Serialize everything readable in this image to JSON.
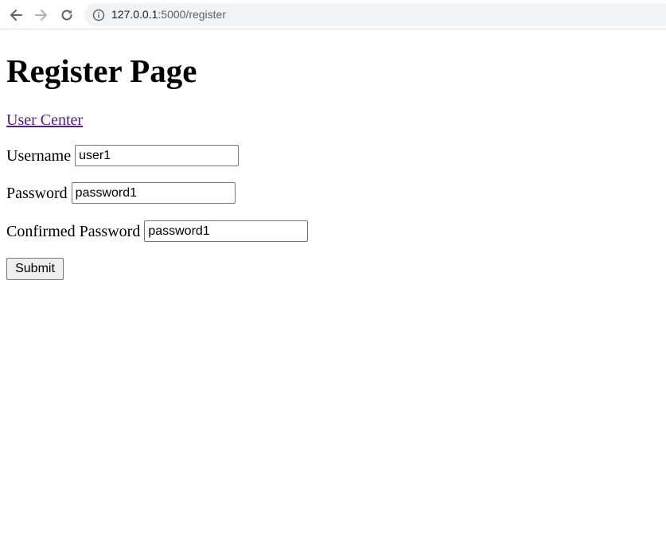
{
  "browser": {
    "url_host": "127.0.0.1",
    "url_path": ":5000/register",
    "back_icon": "arrow-left-icon",
    "forward_icon": "arrow-right-icon",
    "reload_icon": "reload-icon",
    "info_icon": "info-icon"
  },
  "page": {
    "title": "Register Page",
    "user_center_link": "User Center"
  },
  "form": {
    "username_label": "Username",
    "username_value": "user1",
    "password_label": "Password",
    "password_value": "password1",
    "confirm_label": "Confirmed Password",
    "confirm_value": "password1",
    "submit_label": "Submit"
  },
  "colors": {
    "link_visited": "#551a8b",
    "omnibox_bg": "#f1f3f4"
  }
}
